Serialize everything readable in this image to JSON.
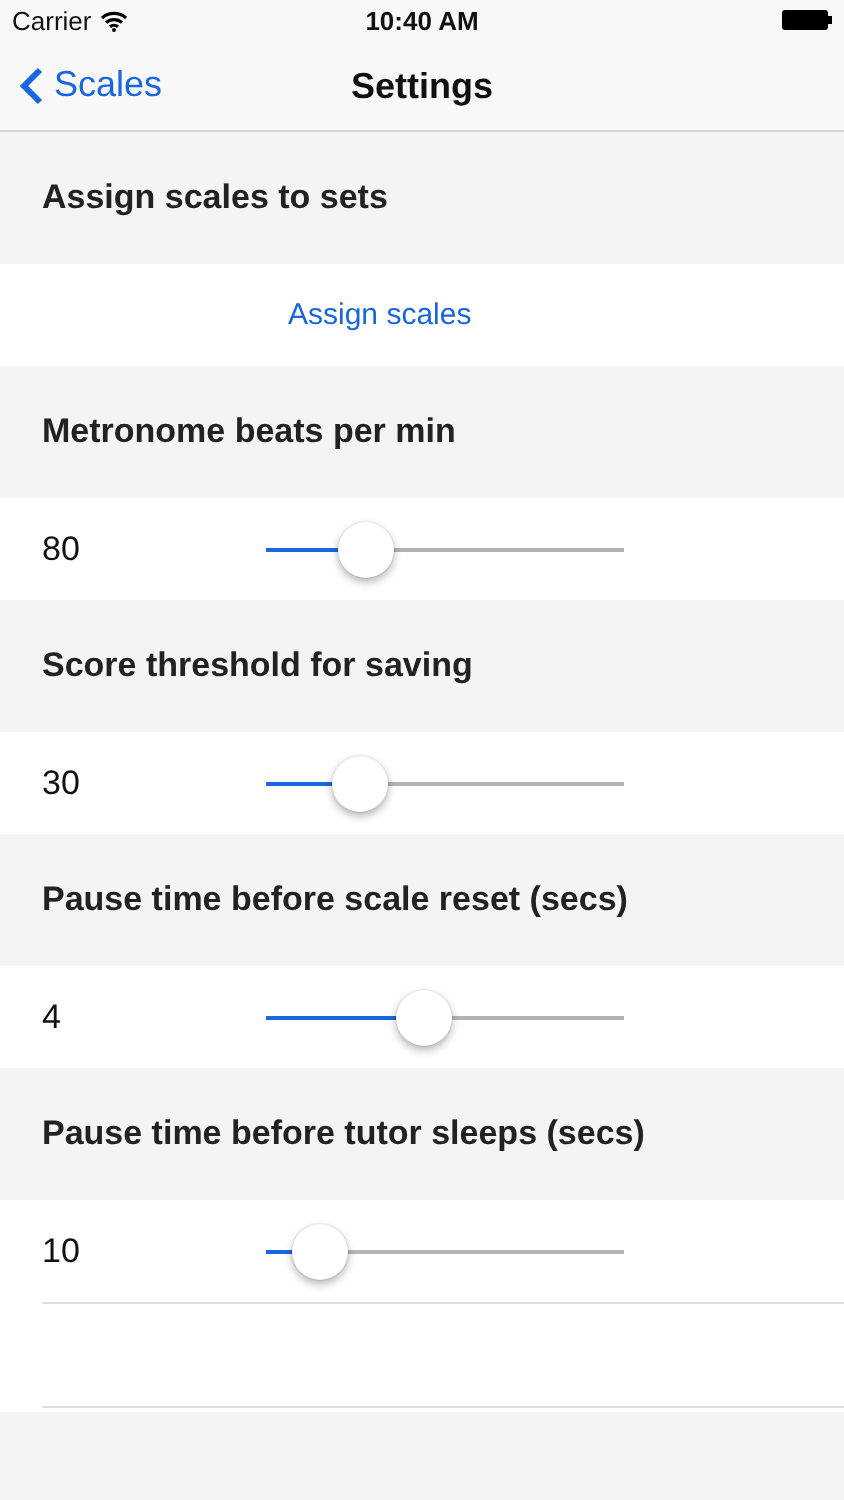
{
  "status_bar": {
    "carrier": "Carrier",
    "time": "10:40 AM"
  },
  "nav": {
    "back": "Scales",
    "title": "Settings"
  },
  "sections": [
    {
      "header": "Assign scales to sets",
      "kind": "button",
      "label": "Assign scales"
    },
    {
      "header": "Metronome beats per min",
      "kind": "slider",
      "value": "80",
      "level": 0.28
    },
    {
      "header": "Score threshold for saving",
      "kind": "slider",
      "value": "30",
      "level": 0.26
    },
    {
      "header": "Pause time before scale reset (secs)",
      "kind": "slider",
      "value": "4",
      "level": 0.44
    },
    {
      "header": "Pause time before tutor sleeps (secs)",
      "kind": "slider",
      "value": "10",
      "level": 0.15
    }
  ]
}
